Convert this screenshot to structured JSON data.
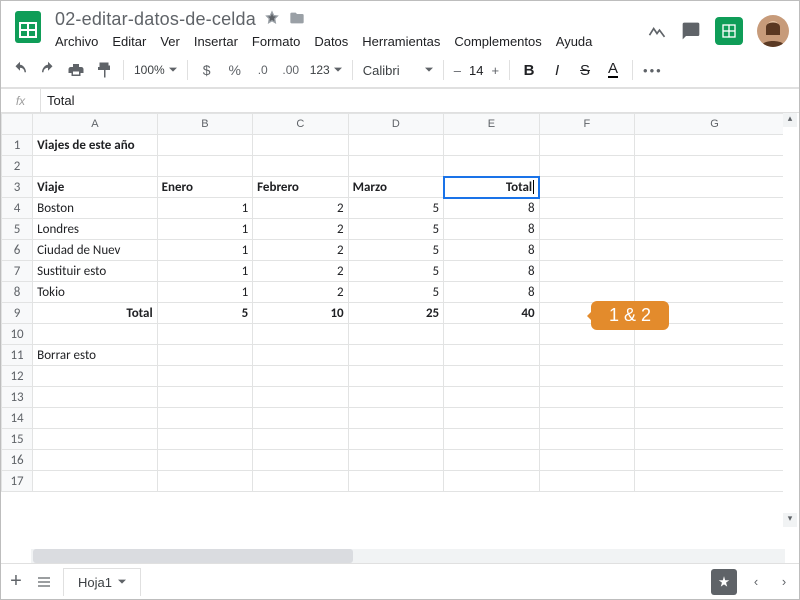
{
  "doc": {
    "name": "02-editar-datos-de-celda"
  },
  "menus": [
    "Archivo",
    "Editar",
    "Ver",
    "Insertar",
    "Formato",
    "Datos",
    "Herramientas",
    "Complementos",
    "Ayuda"
  ],
  "toolbar": {
    "zoom": "100%",
    "fmt": "123",
    "font": "Calibri",
    "size": "14"
  },
  "fx": {
    "value": "Total"
  },
  "cols": [
    "A",
    "B",
    "C",
    "D",
    "E",
    "F",
    "G"
  ],
  "rows": [
    "1",
    "2",
    "3",
    "4",
    "5",
    "6",
    "7",
    "8",
    "9",
    "10",
    "11",
    "12",
    "13",
    "14",
    "15",
    "16",
    "17"
  ],
  "cells": {
    "A1": "Viajes de este año",
    "A3": "Viaje",
    "B3": "Enero",
    "C3": "Febrero",
    "D3": "Marzo",
    "E3": "Total",
    "A4": "Boston",
    "B4": "1",
    "C4": "2",
    "D4": "5",
    "E4": "8",
    "A5": "Londres",
    "B5": "1",
    "C5": "2",
    "D5": "5",
    "E5": "8",
    "A6": "Ciudad de Nuev",
    "B6": "1",
    "C6": "2",
    "D6": "5",
    "E6": "8",
    "A7": "Sustituir esto",
    "B7": "1",
    "C7": "2",
    "D7": "5",
    "E7": "8",
    "A8": "Tokio",
    "B8": "1",
    "C8": "2",
    "D8": "5",
    "E8": "8",
    "A9": "Total",
    "B9": "5",
    "C9": "10",
    "D9": "25",
    "E9": "40",
    "A11": "Borrar esto"
  },
  "callout": "1 & 2",
  "sheet_tab": "Hoja1"
}
